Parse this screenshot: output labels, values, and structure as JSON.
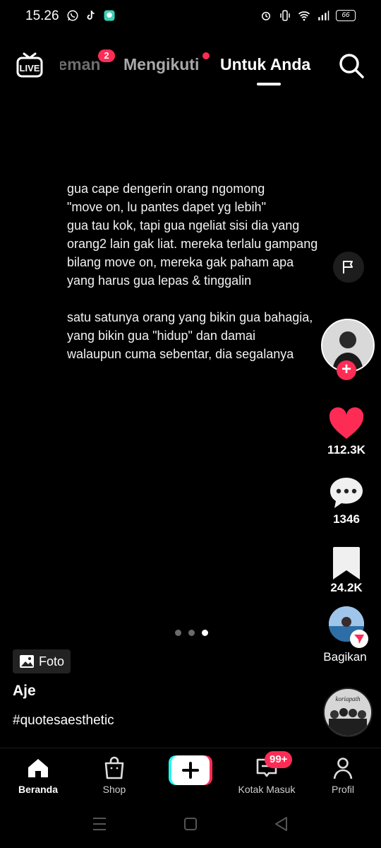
{
  "status_bar": {
    "time": "15.26",
    "battery": "66"
  },
  "top_nav": {
    "tabs": [
      {
        "label": "Teman"
      },
      {
        "label": "Mengikuti"
      },
      {
        "label": "Untuk Anda"
      }
    ],
    "friends_badge": "2"
  },
  "post": {
    "caption": "gua cape dengerin orang ngomong\n\"move on, lu pantes dapet yg lebih\"\ngua tau kok, tapi gua ngeliat sisi dia yang\norang2 lain gak liat. mereka terlalu gampang bilang move on, mereka gak paham apa yang harus gua lepas & tinggalin\n\nsatu satunya orang yang bikin gua bahagia, yang bikin gua \"hidup\" dan damai\nwalaupun cuma sebentar, dia segalanya",
    "tag_label": "Foto",
    "author": "Aje",
    "hashtag": "#quotesaesthetic",
    "carousel": {
      "count": 3,
      "active_index": 2
    }
  },
  "rail": {
    "likes": "112.3K",
    "comments": "1346",
    "bookmarks": "24.2K",
    "share_label": "Bagikan",
    "music_label": "koriapath"
  },
  "bottom_nav": {
    "home": "Beranda",
    "shop": "Shop",
    "inbox": "Kotak Masuk",
    "inbox_badge": "99+",
    "profile": "Profil"
  },
  "colors": {
    "accent": "#fe2c55",
    "cyan": "#25f4ee",
    "background": "#000000"
  }
}
